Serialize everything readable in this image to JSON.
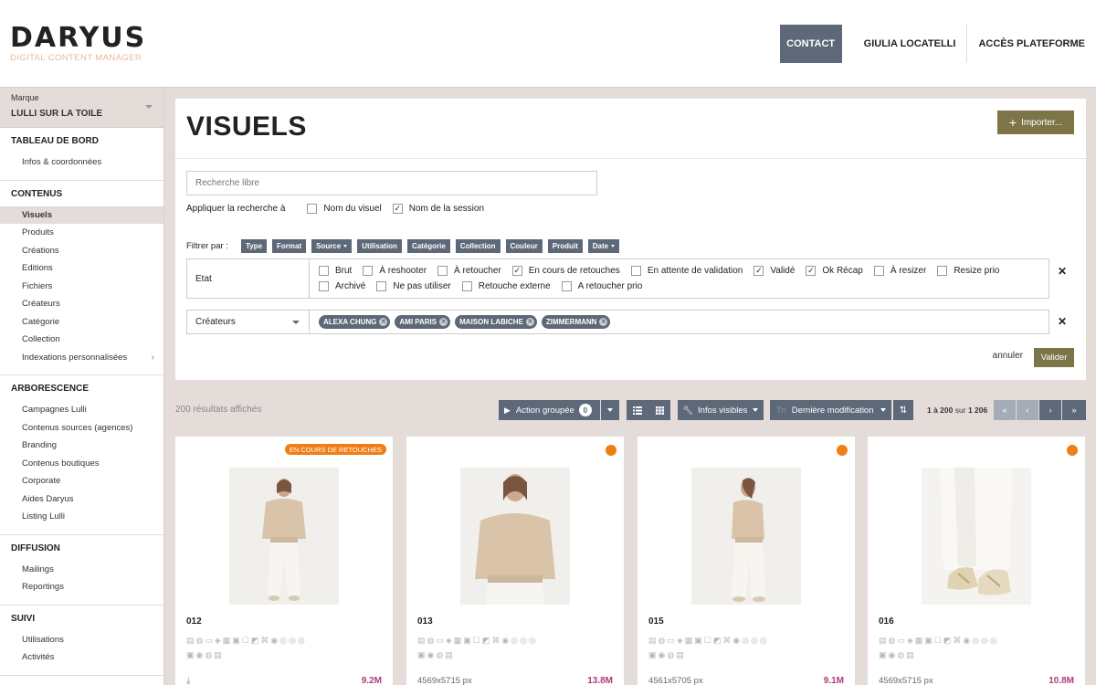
{
  "header": {
    "logo_title": "DARYUS",
    "logo_subtitle": "DIGITAL CONTENT MANAGER",
    "nav": {
      "contact": "CONTACT",
      "user": "GIULIA LOCATELLI",
      "platform": "ACCÈS PLATEFORME"
    }
  },
  "sidebar": {
    "brand_label": "Marque",
    "brand_value": "LULLI SUR LA TOILE",
    "sections": [
      {
        "title": "TABLEAU DE BORD",
        "items": [
          "Infos & coordonnées"
        ]
      },
      {
        "title": "CONTENUS",
        "items": [
          "Visuels",
          "Produits",
          "Créations",
          "Editions",
          "Fichiers",
          "Créateurs",
          "Catégorie",
          "Collection",
          "Indexations personnalisées"
        ]
      },
      {
        "title": "ARBORESCENCE",
        "items": [
          "Campagnes Lulli",
          "Contenus sources (agences)",
          "Branding",
          "Contenus boutiques",
          "Corporate",
          "Aides Daryus",
          "Listing Lulli"
        ]
      },
      {
        "title": "DIFFUSION",
        "items": [
          "Mailings",
          "Reportings"
        ]
      },
      {
        "title": "SUIVI",
        "items": [
          "Utilisations",
          "Activités"
        ]
      }
    ],
    "active_item": "Visuels"
  },
  "panel": {
    "title": "VISUELS",
    "import_label": "Importer...",
    "search_placeholder": "Recherche libre",
    "apply_label": "Appliquer la recherche à",
    "apply_options": [
      {
        "label": "Nom du visuel",
        "checked": false
      },
      {
        "label": "Nom de la session",
        "checked": true
      }
    ],
    "filter_label": "Filtrer par :",
    "filter_tags": [
      "Type",
      "Format",
      "Source",
      "Utilisation",
      "Catégorie",
      "Collection",
      "Couleur",
      "Produit",
      "Date"
    ],
    "etat_label": "Etat",
    "etat_row1": [
      {
        "label": "Brut",
        "checked": false
      },
      {
        "label": "À reshooter",
        "checked": false
      },
      {
        "label": "À retoucher",
        "checked": false
      },
      {
        "label": "En cours de retouches",
        "checked": true
      },
      {
        "label": "En attente de validation",
        "checked": false
      },
      {
        "label": "Validé",
        "checked": true
      },
      {
        "label": "Ok Récap",
        "checked": true
      },
      {
        "label": "À resizer",
        "checked": false
      },
      {
        "label": "Resize prio",
        "checked": false
      }
    ],
    "etat_row2": [
      {
        "label": "Archivé",
        "checked": false
      },
      {
        "label": "Ne pas utiliser",
        "checked": false
      },
      {
        "label": "Retouche externe",
        "checked": false
      },
      {
        "label": "A retoucher prio",
        "checked": false
      }
    ],
    "createurs_label": "Créateurs",
    "createurs_chips": [
      "ALEXA CHUNG",
      "AMI PARIS",
      "MAISON LABICHE",
      "ZIMMERMANN"
    ],
    "cancel_label": "annuler",
    "validate_label": "Valider"
  },
  "toolbar": {
    "results": "200 résultats affichés",
    "action_label": "Action groupée",
    "action_count": "0",
    "infos_label": "Infos visibles",
    "sort_prefix": "Tri",
    "sort_label": "Dernière modification",
    "pager_range": "1 à 200",
    "pager_of": "sur",
    "pager_total": "1 206"
  },
  "cards": [
    {
      "name": "012",
      "status": "EN COURS DE RETOUCHES",
      "dims": "",
      "size": "9.2M",
      "variant": "full-front"
    },
    {
      "name": "013",
      "status": "",
      "dims": "4569x5715 px",
      "size": "13.8M",
      "variant": "closeup"
    },
    {
      "name": "015",
      "status": "",
      "dims": "4561x5705 px",
      "size": "9.1M",
      "variant": "side"
    },
    {
      "name": "016",
      "status": "",
      "dims": "4569x5715 px",
      "size": "10.8M",
      "variant": "shoes"
    }
  ],
  "colors": {
    "accent_olive": "#7d7548",
    "slate": "#5d6878",
    "status_orange": "#f07e16",
    "size_magenta": "#b03a7a",
    "bg_taupe": "#e4dcd9"
  }
}
